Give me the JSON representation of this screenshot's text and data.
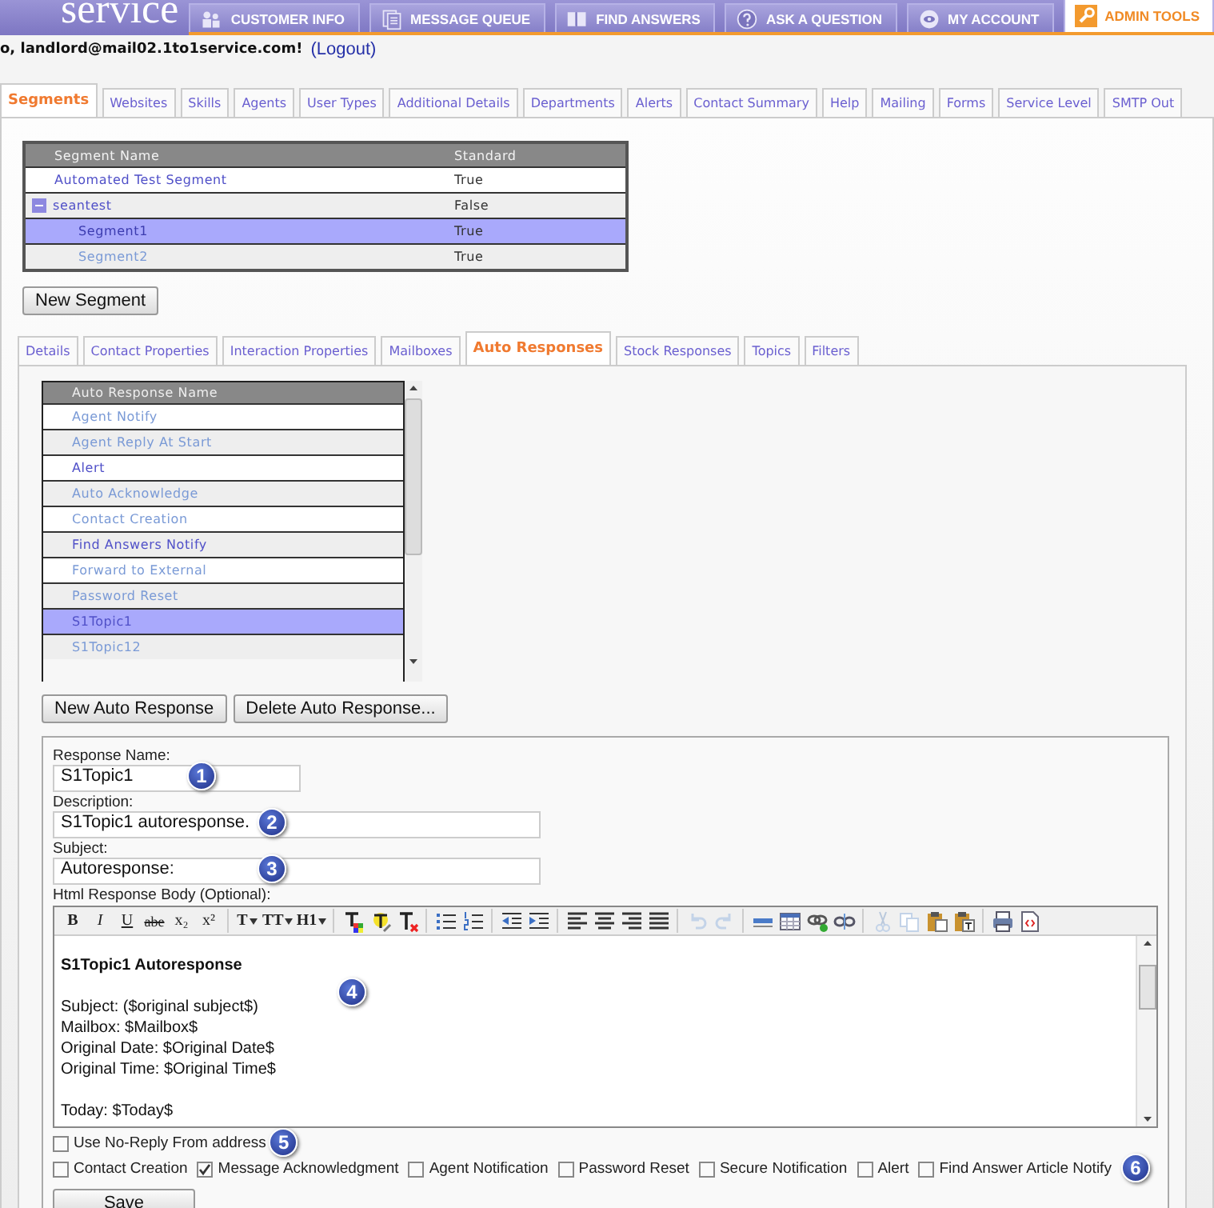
{
  "header": {
    "logo": "service",
    "nav": [
      {
        "label": "CUSTOMER INFO",
        "kind": "people",
        "selected": false
      },
      {
        "label": "MESSAGE QUEUE",
        "kind": "document",
        "selected": false
      },
      {
        "label": "FIND ANSWERS",
        "kind": "book",
        "selected": false
      },
      {
        "label": "ASK A QUESTION",
        "kind": "question",
        "selected": false
      },
      {
        "label": "MY ACCOUNT",
        "kind": "eye",
        "selected": false
      },
      {
        "label": "ADMIN TOOLS",
        "kind": "wrench",
        "selected": true
      }
    ]
  },
  "user_bar": {
    "greeting": "o, landlord@mail02.1to1service.com!",
    "logout": "(Logout)"
  },
  "admin_tabs": [
    {
      "label": "Segments",
      "selected": true
    },
    {
      "label": "Websites",
      "selected": false
    },
    {
      "label": "Skills",
      "selected": false
    },
    {
      "label": "Agents",
      "selected": false
    },
    {
      "label": "User Types",
      "selected": false
    },
    {
      "label": "Additional Details",
      "selected": false
    },
    {
      "label": "Departments",
      "selected": false
    },
    {
      "label": "Alerts",
      "selected": false
    },
    {
      "label": "Contact Summary",
      "selected": false
    },
    {
      "label": "Help",
      "selected": false
    },
    {
      "label": "Mailing",
      "selected": false
    },
    {
      "label": "Forms",
      "selected": false
    },
    {
      "label": "Service Level",
      "selected": false
    },
    {
      "label": "SMTP Out",
      "selected": false
    }
  ],
  "segments": {
    "columns": [
      "Segment Name",
      "Standard"
    ],
    "rows": [
      {
        "name": "Automated Test Segment",
        "standard": "True",
        "selected": false
      },
      {
        "name": "seantest",
        "standard": "False",
        "selected": false,
        "expanded": true,
        "children": [
          {
            "name": "Segment1",
            "standard": "True",
            "selected": true
          },
          {
            "name": "Segment2",
            "standard": "True",
            "selected": false
          }
        ]
      }
    ]
  },
  "new_segment_button": "New Segment",
  "segment_tabs": [
    {
      "label": "Details",
      "selected": false
    },
    {
      "label": "Contact Properties",
      "selected": false
    },
    {
      "label": "Interaction Properties",
      "selected": false
    },
    {
      "label": "Mailboxes",
      "selected": false
    },
    {
      "label": "Auto Responses",
      "selected": true
    },
    {
      "label": "Stock Responses",
      "selected": false
    },
    {
      "label": "Topics",
      "selected": false
    },
    {
      "label": "Filters",
      "selected": false
    }
  ],
  "auto_responses": {
    "column": "Auto Response Name",
    "rows": [
      {
        "name": "Agent Notify",
        "selected": false
      },
      {
        "name": "Agent Reply At Start",
        "selected": false
      },
      {
        "name": "Alert",
        "selected": false
      },
      {
        "name": "Auto Acknowledge",
        "selected": false
      },
      {
        "name": "Contact Creation",
        "selected": false
      },
      {
        "name": "Find Answers Notify",
        "selected": false
      },
      {
        "name": "Forward to External",
        "selected": false
      },
      {
        "name": "Password Reset",
        "selected": false
      },
      {
        "name": "S1Topic1",
        "selected": true
      },
      {
        "name": "S1Topic12",
        "selected": false
      }
    ],
    "buttons": [
      "New Auto Response",
      "Delete Auto Response..."
    ]
  },
  "form": {
    "fields": [
      {
        "label": "Response Name:",
        "value": "S1Topic1",
        "callout": "1",
        "kind": "short"
      },
      {
        "label": "Description:",
        "value": "S1Topic1 autoresponse.",
        "callout": "2",
        "kind": "long"
      },
      {
        "label": "Subject:",
        "value": "Autoresponse:",
        "callout": "3",
        "kind": "long"
      }
    ],
    "body": {
      "label": "Html Response Body (Optional):",
      "callout": "4",
      "toolbar": [
        [
          {
            "kind": "text",
            "label": "B"
          },
          {
            "kind": "text",
            "label": "I"
          },
          {
            "kind": "text",
            "label": "U"
          },
          {
            "kind": "text",
            "label": "abe"
          },
          {
            "kind": "text",
            "label": "x₂"
          },
          {
            "kind": "text",
            "label": "x²"
          }
        ],
        [
          {
            "kind": "menu",
            "label": "T"
          },
          {
            "kind": "menu",
            "label": "TT"
          },
          {
            "kind": "menu",
            "label": "H1"
          }
        ],
        [
          {
            "kind": "text-color"
          },
          {
            "kind": "highlight"
          },
          {
            "kind": "clear-format"
          }
        ],
        [
          {
            "kind": "bullet-list"
          },
          {
            "kind": "numbered-list"
          }
        ],
        [
          {
            "kind": "outdent"
          },
          {
            "kind": "indent"
          }
        ],
        [
          {
            "kind": "align-left"
          },
          {
            "kind": "align-center"
          },
          {
            "kind": "align-right"
          },
          {
            "kind": "justify"
          }
        ],
        [
          {
            "kind": "undo",
            "disabled": true
          },
          {
            "kind": "redo",
            "disabled": true
          }
        ],
        [
          {
            "kind": "rule"
          },
          {
            "kind": "table"
          },
          {
            "kind": "link"
          },
          {
            "kind": "unlink"
          }
        ],
        [
          {
            "kind": "cut",
            "disabled": true
          },
          {
            "kind": "copy",
            "disabled": true
          },
          {
            "kind": "paste"
          },
          {
            "kind": "paste-text"
          }
        ],
        [
          {
            "kind": "print"
          },
          {
            "kind": "source"
          }
        ]
      ],
      "heading": "S1Topic1 Autoresponse",
      "paragraphs": [
        [
          "Subject: ($original subject$)",
          "Mailbox: $Mailbox$",
          "Original Date: $Original Date$",
          "Original Time: $Original Time$"
        ],
        [
          "Today: $Today$"
        ]
      ]
    },
    "no_reply": {
      "label": "Use No-Reply From address",
      "checked": false,
      "callout": "5"
    },
    "notifications": [
      {
        "label": "Contact Creation",
        "checked": false
      },
      {
        "label": "Message Acknowledgment",
        "checked": true
      },
      {
        "label": "Agent Notification",
        "checked": false
      },
      {
        "label": "Password Reset",
        "checked": false
      },
      {
        "label": "Secure Notification",
        "checked": false
      },
      {
        "label": "Alert",
        "checked": false
      },
      {
        "label": "Find Answer Article Notify",
        "checked": false
      }
    ],
    "notifications_callout": "6",
    "save_button": "Save"
  }
}
